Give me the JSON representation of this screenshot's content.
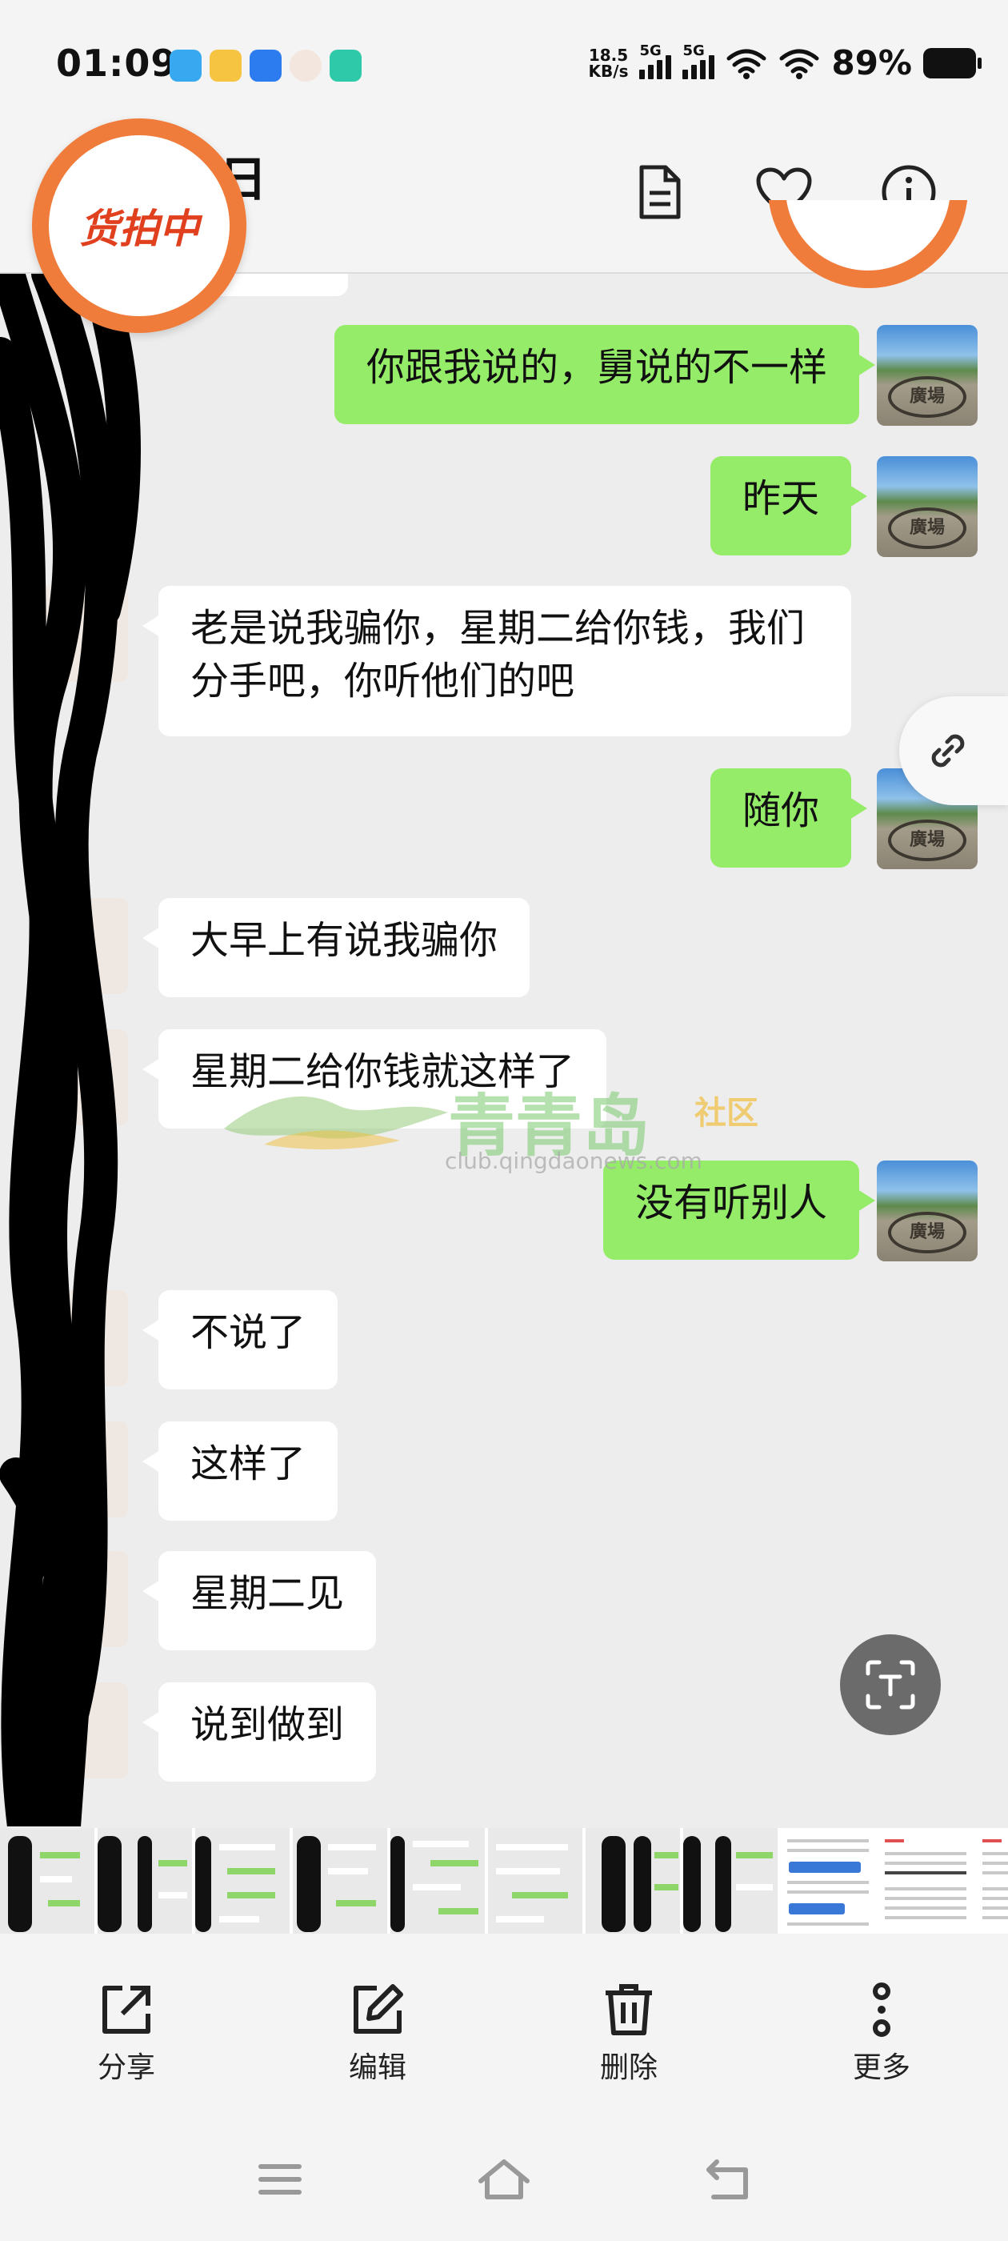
{
  "status_bar": {
    "time": "01:09",
    "net_speed_value": "18.5",
    "net_speed_unit": "KB/s",
    "sim1_label": "5G",
    "sim2_label": "5G",
    "battery": "89%"
  },
  "header": {
    "title_partial": "6日",
    "icons": [
      "document-icon",
      "heart-icon",
      "info-icon"
    ]
  },
  "badge": {
    "text": "货拍中"
  },
  "messages": [
    {
      "side": "out",
      "text": "你跟我说的，舅说的不一样"
    },
    {
      "side": "out",
      "text": "昨天"
    },
    {
      "side": "in",
      "text": "老是说我骗你，星期二给你钱，我们分手吧，你听他们的吧"
    },
    {
      "side": "out",
      "text": "随你"
    },
    {
      "side": "in",
      "text": "大早上有说我骗你"
    },
    {
      "side": "in",
      "text": "星期二给你钱就这样了"
    },
    {
      "side": "out",
      "text": "没有听别人"
    },
    {
      "side": "in",
      "text": "不说了"
    },
    {
      "side": "in",
      "text": "这样了"
    },
    {
      "side": "in",
      "text": "星期二见"
    },
    {
      "side": "in",
      "text": "说到做到"
    }
  ],
  "avatar_text": "廣場",
  "watermark": {
    "main": "青青岛",
    "side": "社区",
    "url": "club.qingdaonews.com"
  },
  "actions": [
    {
      "label": "分享",
      "icon": "share-icon"
    },
    {
      "label": "编辑",
      "icon": "edit-icon"
    },
    {
      "label": "删除",
      "icon": "trash-icon"
    },
    {
      "label": "更多",
      "icon": "more-icon"
    }
  ],
  "colors": {
    "outgoing_bubble": "#95ec69",
    "incoming_bubble": "#ffffff",
    "badge_orange": "#f07c3c"
  }
}
